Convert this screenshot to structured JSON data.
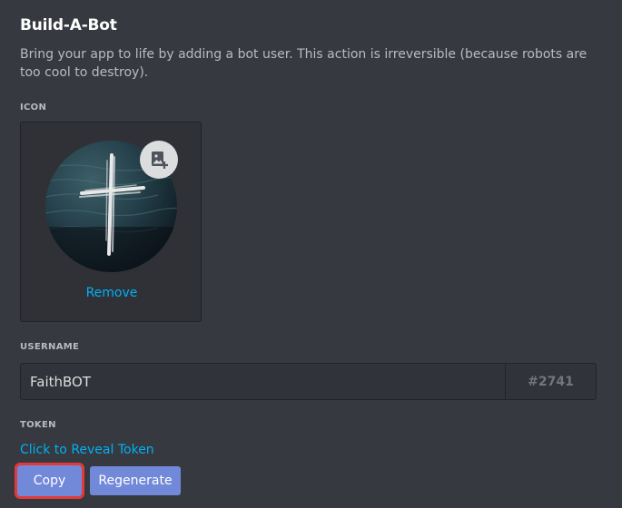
{
  "header": {
    "title": "Build-A-Bot",
    "description": "Bring your app to life by adding a bot user. This action is irreversible (because robots are too cool to destroy)."
  },
  "icon_section": {
    "label": "ICON",
    "remove_label": "Remove",
    "upload_icon": "image-upload-icon"
  },
  "username_section": {
    "label": "USERNAME",
    "value": "FaithBOT",
    "discriminator": "#2741"
  },
  "token_section": {
    "label": "TOKEN",
    "reveal_label": "Click to Reveal Token",
    "copy_label": "Copy",
    "regenerate_label": "Regenerate"
  },
  "colors": {
    "background": "#36393f",
    "accent": "#7289da",
    "link": "#00b0f4",
    "highlight": "#e23a3a"
  }
}
